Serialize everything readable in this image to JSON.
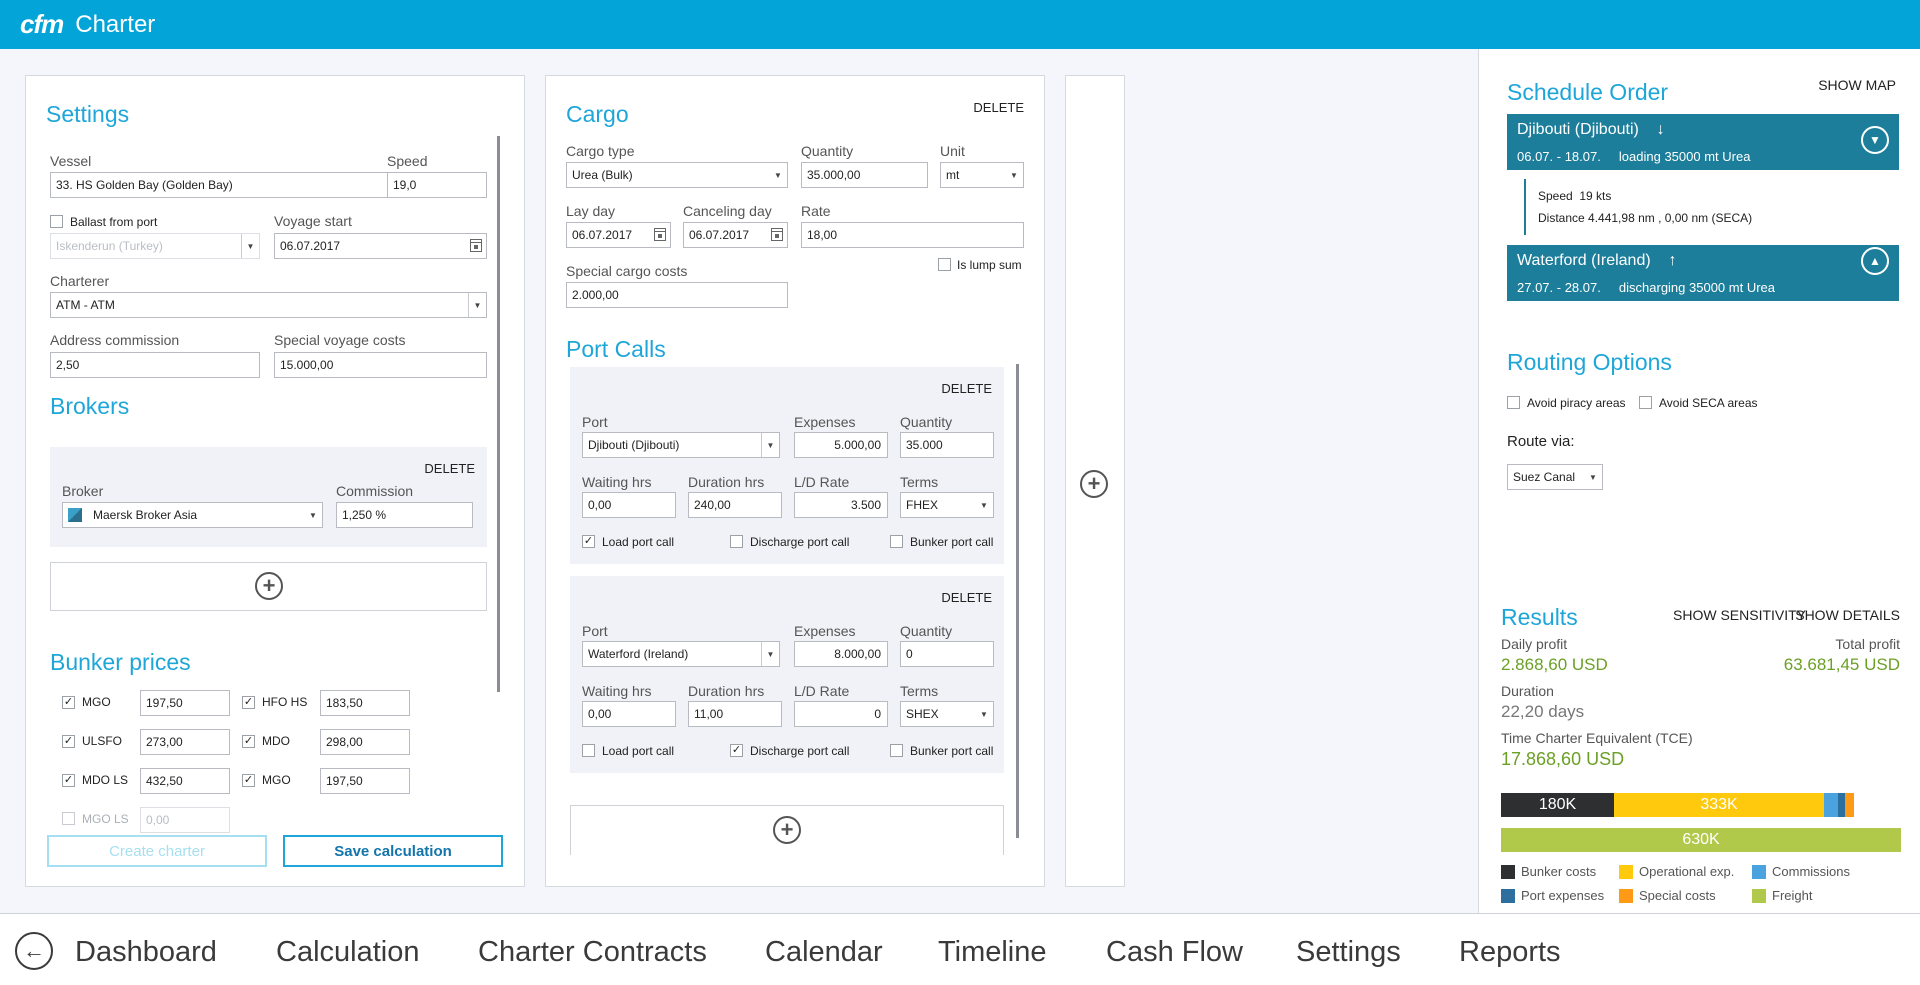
{
  "app": {
    "logo": "cfm",
    "title": "Charter"
  },
  "settings": {
    "title": "Settings",
    "vessel_label": "Vessel",
    "vessel_value": "33. HS Golden Bay (Golden Bay)",
    "speed_label": "Speed",
    "speed_value": "19,0",
    "ballast_label": "Ballast from port",
    "ballast_checked": false,
    "ballast_port_value": "Iskenderun (Turkey)",
    "voyage_start_label": "Voyage start",
    "voyage_start_value": "06.07.2017",
    "charterer_label": "Charterer",
    "charterer_value": "ATM - ATM",
    "address_commission_label": "Address commission",
    "address_commission_value": "2,50",
    "special_voyage_costs_label": "Special voyage costs",
    "special_voyage_costs_value": "15.000,00"
  },
  "brokers": {
    "title": "Brokers",
    "delete": "DELETE",
    "broker_label": "Broker",
    "broker_value": "Maersk Broker Asia",
    "commission_label": "Commission",
    "commission_value": "1,250 %"
  },
  "bunker": {
    "title": "Bunker prices",
    "items": [
      {
        "name": "MGO",
        "value": "197,50",
        "checked": true
      },
      {
        "name": "HFO HS",
        "value": "183,50",
        "checked": true
      },
      {
        "name": "ULSFO",
        "value": "273,00",
        "checked": true
      },
      {
        "name": "MDO",
        "value": "298,00",
        "checked": true
      },
      {
        "name": "MDO LS",
        "value": "432,50",
        "checked": true
      },
      {
        "name": "MGO",
        "value": "197,50",
        "checked": true
      },
      {
        "name": "MGO LS",
        "value": "0,00",
        "checked": false
      }
    ]
  },
  "actions": {
    "create_charter": "Create charter",
    "save_calculation": "Save calculation"
  },
  "cargo": {
    "title": "Cargo",
    "delete": "DELETE",
    "cargo_type_label": "Cargo type",
    "cargo_type_value": "Urea (Bulk)",
    "quantity_label": "Quantity",
    "quantity_value": "35.000,00",
    "unit_label": "Unit",
    "unit_value": "mt",
    "lay_day_label": "Lay day",
    "lay_day_value": "06.07.2017",
    "canceling_day_label": "Canceling day",
    "canceling_day_value": "06.07.2017",
    "rate_label": "Rate",
    "rate_value": "18,00",
    "lump_sum_label": "Is lump sum",
    "special_costs_label": "Special cargo costs",
    "special_costs_value": "2.000,00"
  },
  "port_calls": {
    "title": "Port Calls",
    "labels": {
      "port": "Port",
      "expenses": "Expenses",
      "quantity": "Quantity",
      "waiting": "Waiting hrs",
      "duration": "Duration hrs",
      "ld_rate": "L/D Rate",
      "terms": "Terms",
      "load": "Load port call",
      "discharge": "Discharge port call",
      "bunker": "Bunker port call",
      "delete": "DELETE"
    },
    "calls": [
      {
        "port": "Djibouti (Djibouti)",
        "expenses": "5.000,00",
        "quantity": "35.000",
        "waiting": "0,00",
        "duration": "240,00",
        "ld_rate": "3.500",
        "terms": "FHEX",
        "load": true,
        "discharge": false,
        "bunker": false
      },
      {
        "port": "Waterford (Ireland)",
        "expenses": "8.000,00",
        "quantity": "0",
        "waiting": "0,00",
        "duration": "11,00",
        "ld_rate": "0",
        "terms": "SHEX",
        "load": false,
        "discharge": true,
        "bunker": false
      }
    ]
  },
  "schedule": {
    "title": "Schedule Order",
    "show_map": "SHOW MAP",
    "stop1_port": "Djibouti (Djibouti)",
    "stop1_arrow": "↓",
    "stop1_dates": "06.07. - 18.07.",
    "stop1_action": "loading 35000 mt Urea",
    "speed_label": "Speed",
    "speed_value": "19 kts",
    "distance_label": "Distance",
    "distance_value": "4.441,98 nm ,  0,00 nm (SECA)",
    "stop2_port": "Waterford (Ireland)",
    "stop2_arrow": "↑",
    "stop2_dates": "27.07. - 28.07.",
    "stop2_action": "discharging 35000 mt Urea"
  },
  "routing": {
    "title": "Routing Options",
    "avoid_piracy": "Avoid piracy areas",
    "avoid_seca": "Avoid SECA areas",
    "route_via_label": "Route via:",
    "route_via_value": "Suez Canal"
  },
  "results": {
    "title": "Results",
    "show_sensitivity": "SHOW SENSITIVITY",
    "show_details": "SHOW DETAILS",
    "daily_profit_label": "Daily profit",
    "daily_profit_value": "2.868,60 USD",
    "total_profit_label": "Total profit",
    "total_profit_value": "63.681,45 USD",
    "duration_label": "Duration",
    "duration_value": "22,20 days",
    "tce_label": "Time Charter Equivalent (TCE)",
    "tce_value": "17.868,60 USD",
    "bar1_label1": "180K",
    "bar1_label2": "333K",
    "bar2_label": "630K",
    "colors": {
      "bunker": "#2e2f31",
      "operational": "#ffc90e",
      "commissions": "#4aa3df",
      "port": "#2c6f9e",
      "special": "#ff9a17",
      "freight": "#b1c94a"
    },
    "legend": [
      "Bunker costs",
      "Operational exp.",
      "Commissions",
      "Port expenses",
      "Special costs",
      "Freight"
    ]
  },
  "nav": {
    "back": "←",
    "items": [
      "Dashboard",
      "Calculation",
      "Charter Contracts",
      "Calendar",
      "Timeline",
      "Cash Flow",
      "Settings",
      "Reports"
    ]
  }
}
